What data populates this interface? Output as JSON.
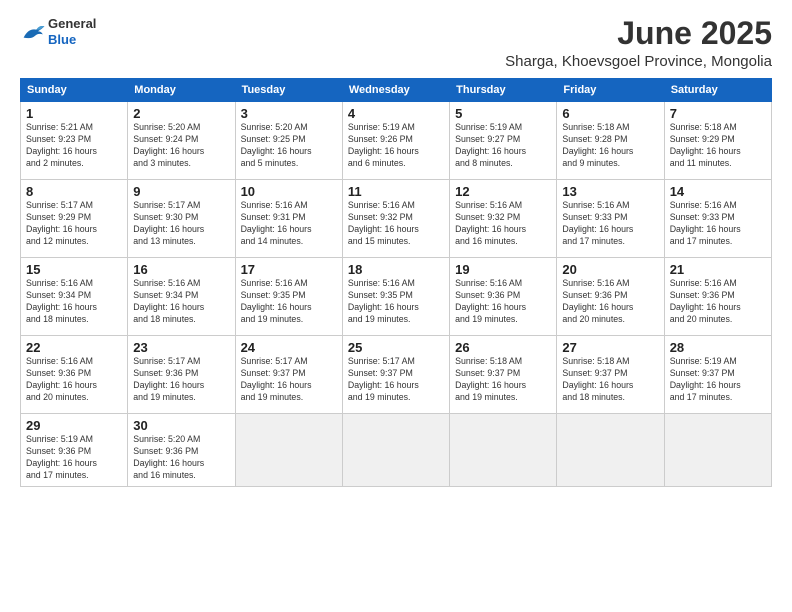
{
  "logo": {
    "general": "General",
    "blue": "Blue"
  },
  "header": {
    "month": "June 2025",
    "location": "Sharga, Khoevsgoel Province, Mongolia"
  },
  "weekdays": [
    "Sunday",
    "Monday",
    "Tuesday",
    "Wednesday",
    "Thursday",
    "Friday",
    "Saturday"
  ],
  "weeks": [
    [
      {
        "day": "1",
        "info": "Sunrise: 5:21 AM\nSunset: 9:23 PM\nDaylight: 16 hours\nand 2 minutes."
      },
      {
        "day": "2",
        "info": "Sunrise: 5:20 AM\nSunset: 9:24 PM\nDaylight: 16 hours\nand 3 minutes."
      },
      {
        "day": "3",
        "info": "Sunrise: 5:20 AM\nSunset: 9:25 PM\nDaylight: 16 hours\nand 5 minutes."
      },
      {
        "day": "4",
        "info": "Sunrise: 5:19 AM\nSunset: 9:26 PM\nDaylight: 16 hours\nand 6 minutes."
      },
      {
        "day": "5",
        "info": "Sunrise: 5:19 AM\nSunset: 9:27 PM\nDaylight: 16 hours\nand 8 minutes."
      },
      {
        "day": "6",
        "info": "Sunrise: 5:18 AM\nSunset: 9:28 PM\nDaylight: 16 hours\nand 9 minutes."
      },
      {
        "day": "7",
        "info": "Sunrise: 5:18 AM\nSunset: 9:29 PM\nDaylight: 16 hours\nand 11 minutes."
      }
    ],
    [
      {
        "day": "8",
        "info": "Sunrise: 5:17 AM\nSunset: 9:29 PM\nDaylight: 16 hours\nand 12 minutes."
      },
      {
        "day": "9",
        "info": "Sunrise: 5:17 AM\nSunset: 9:30 PM\nDaylight: 16 hours\nand 13 minutes."
      },
      {
        "day": "10",
        "info": "Sunrise: 5:16 AM\nSunset: 9:31 PM\nDaylight: 16 hours\nand 14 minutes."
      },
      {
        "day": "11",
        "info": "Sunrise: 5:16 AM\nSunset: 9:32 PM\nDaylight: 16 hours\nand 15 minutes."
      },
      {
        "day": "12",
        "info": "Sunrise: 5:16 AM\nSunset: 9:32 PM\nDaylight: 16 hours\nand 16 minutes."
      },
      {
        "day": "13",
        "info": "Sunrise: 5:16 AM\nSunset: 9:33 PM\nDaylight: 16 hours\nand 17 minutes."
      },
      {
        "day": "14",
        "info": "Sunrise: 5:16 AM\nSunset: 9:33 PM\nDaylight: 16 hours\nand 17 minutes."
      }
    ],
    [
      {
        "day": "15",
        "info": "Sunrise: 5:16 AM\nSunset: 9:34 PM\nDaylight: 16 hours\nand 18 minutes."
      },
      {
        "day": "16",
        "info": "Sunrise: 5:16 AM\nSunset: 9:34 PM\nDaylight: 16 hours\nand 18 minutes."
      },
      {
        "day": "17",
        "info": "Sunrise: 5:16 AM\nSunset: 9:35 PM\nDaylight: 16 hours\nand 19 minutes."
      },
      {
        "day": "18",
        "info": "Sunrise: 5:16 AM\nSunset: 9:35 PM\nDaylight: 16 hours\nand 19 minutes."
      },
      {
        "day": "19",
        "info": "Sunrise: 5:16 AM\nSunset: 9:36 PM\nDaylight: 16 hours\nand 19 minutes."
      },
      {
        "day": "20",
        "info": "Sunrise: 5:16 AM\nSunset: 9:36 PM\nDaylight: 16 hours\nand 20 minutes."
      },
      {
        "day": "21",
        "info": "Sunrise: 5:16 AM\nSunset: 9:36 PM\nDaylight: 16 hours\nand 20 minutes."
      }
    ],
    [
      {
        "day": "22",
        "info": "Sunrise: 5:16 AM\nSunset: 9:36 PM\nDaylight: 16 hours\nand 20 minutes."
      },
      {
        "day": "23",
        "info": "Sunrise: 5:17 AM\nSunset: 9:36 PM\nDaylight: 16 hours\nand 19 minutes."
      },
      {
        "day": "24",
        "info": "Sunrise: 5:17 AM\nSunset: 9:37 PM\nDaylight: 16 hours\nand 19 minutes."
      },
      {
        "day": "25",
        "info": "Sunrise: 5:17 AM\nSunset: 9:37 PM\nDaylight: 16 hours\nand 19 minutes."
      },
      {
        "day": "26",
        "info": "Sunrise: 5:18 AM\nSunset: 9:37 PM\nDaylight: 16 hours\nand 19 minutes."
      },
      {
        "day": "27",
        "info": "Sunrise: 5:18 AM\nSunset: 9:37 PM\nDaylight: 16 hours\nand 18 minutes."
      },
      {
        "day": "28",
        "info": "Sunrise: 5:19 AM\nSunset: 9:37 PM\nDaylight: 16 hours\nand 17 minutes."
      }
    ],
    [
      {
        "day": "29",
        "info": "Sunrise: 5:19 AM\nSunset: 9:36 PM\nDaylight: 16 hours\nand 17 minutes."
      },
      {
        "day": "30",
        "info": "Sunrise: 5:20 AM\nSunset: 9:36 PM\nDaylight: 16 hours\nand 16 minutes."
      },
      {
        "day": "",
        "info": ""
      },
      {
        "day": "",
        "info": ""
      },
      {
        "day": "",
        "info": ""
      },
      {
        "day": "",
        "info": ""
      },
      {
        "day": "",
        "info": ""
      }
    ]
  ]
}
